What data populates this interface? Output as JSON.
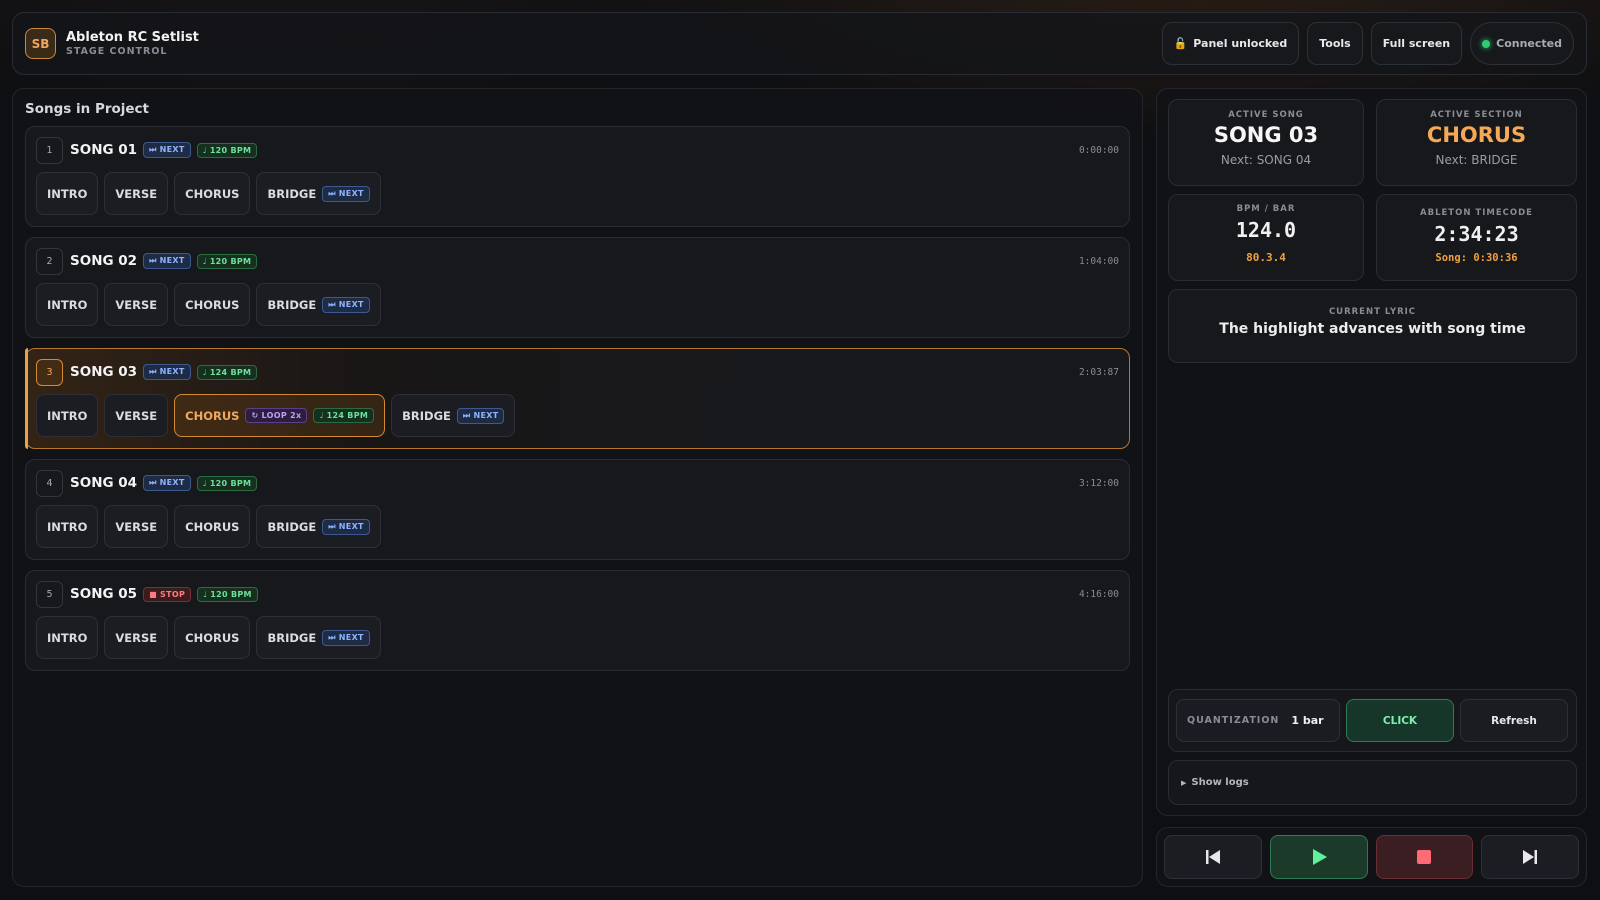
{
  "app": {
    "logo_text": "SB",
    "title": "Ableton RC Setlist",
    "subtitle": "STAGE CONTROL"
  },
  "header": {
    "panel_label": "Panel unlocked",
    "tools_label": "Tools",
    "fullscreen_label": "Full screen",
    "status_label": "Connected"
  },
  "songs_panel": {
    "title": "Songs in Project"
  },
  "songs": [
    {
      "number": "1",
      "name": "SONG 01",
      "action": "⏭ NEXT",
      "bpm": "♩ 120 BPM",
      "timecode": "0:00:00",
      "sections": [
        "INTRO",
        "VERSE",
        "CHORUS",
        "BRIDGE"
      ],
      "bridge_badge": "⏭ NEXT"
    },
    {
      "number": "2",
      "name": "SONG 02",
      "action": "⏭ NEXT",
      "bpm": "♩ 120 BPM",
      "timecode": "1:04:00",
      "sections": [
        "INTRO",
        "VERSE",
        "CHORUS",
        "BRIDGE"
      ],
      "bridge_badge": "⏭ NEXT"
    },
    {
      "number": "3",
      "name": "SONG 03",
      "action": "⏭ NEXT",
      "bpm": "♩ 124 BPM",
      "timecode": "2:03:87",
      "sections": [
        "INTRO",
        "VERSE",
        "CHORUS",
        "BRIDGE"
      ],
      "bridge_badge": "⏭ NEXT",
      "chorus_loop": "↻ LOOP 2x",
      "chorus_bpm": "♩ 124 BPM"
    },
    {
      "number": "4",
      "name": "SONG 04",
      "action": "⏭ NEXT",
      "bpm": "♩ 120 BPM",
      "timecode": "3:12:00",
      "sections": [
        "INTRO",
        "VERSE",
        "CHORUS",
        "BRIDGE"
      ],
      "bridge_badge": "⏭ NEXT"
    },
    {
      "number": "5",
      "name": "SONG 05",
      "action": "■ STOP",
      "bpm": "♩ 120 BPM",
      "timecode": "4:16:00",
      "sections": [
        "INTRO",
        "VERSE",
        "CHORUS",
        "BRIDGE"
      ],
      "bridge_badge": "⏭ NEXT"
    }
  ],
  "status": {
    "active_song_label": "ACTIVE SONG",
    "active_song": "SONG 03",
    "next_song": "Next: SONG 04",
    "active_section_label": "ACTIVE SECTION",
    "active_section": "CHORUS",
    "next_section": "Next: BRIDGE",
    "bpm_label": "BPM / BAR",
    "bpm": "124.0",
    "bar": "80.3.4",
    "timecode_label": "ABLETON TIMECODE",
    "timecode": "2:34:23",
    "song_time": "Song: 0:30:36",
    "lyric_label": "CURRENT LYRIC",
    "lyric": "The highlight advances with song time"
  },
  "controls": {
    "quantization_label": "QUANTIZATION",
    "quantization_value": "1 bar",
    "click_label": "CLICK",
    "refresh_label": "Refresh",
    "logs_label": "Show logs"
  },
  "colors": {
    "accent": "#f0a040",
    "next_badge": "#8fb3ff",
    "bpm_badge": "#6fe09a",
    "stop_badge": "#ff7a80",
    "loop_badge": "#c49bff",
    "connected": "#2ecc71"
  },
  "icons": {
    "lock": "lock-icon",
    "prev": "skip-back-icon",
    "play": "play-icon",
    "stop": "stop-icon",
    "next": "skip-forward-icon"
  }
}
